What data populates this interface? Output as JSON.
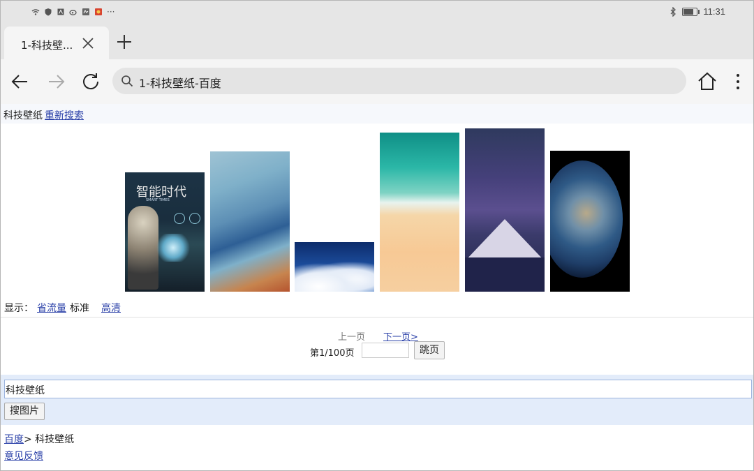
{
  "status_bar": {
    "time": "11:31",
    "left_icons": [
      "wifi-icon",
      "shield-icon",
      "notification-icon",
      "weibo-icon",
      "app-icon",
      "app-icon-2"
    ],
    "more": "···"
  },
  "browser": {
    "tab_title": "1-科技壁...",
    "address": "1-科技壁纸-百度"
  },
  "page": {
    "keyword": "科技壁纸",
    "research_link": "重新搜索",
    "display_label": "显示：",
    "display_options": {
      "save_data": "省流量",
      "standard": "标准",
      "hd": "高清"
    },
    "pager": {
      "prev": "上一页",
      "next": "下一页>",
      "count": "第1/100页",
      "jump": "跳页",
      "page_input": ""
    },
    "search": {
      "value": "科技壁纸",
      "button": "搜图片"
    },
    "breadcrumb": {
      "home": "百度",
      "sep": ">",
      "current": " 科技壁纸"
    },
    "feedback": "意见反馈",
    "images": [
      {
        "name": "image-thumb-1",
        "alt": "智能时代"
      },
      {
        "name": "image-thumb-2",
        "alt": ""
      },
      {
        "name": "image-thumb-3",
        "alt": ""
      },
      {
        "name": "image-thumb-4",
        "alt": ""
      },
      {
        "name": "image-thumb-5",
        "alt": ""
      },
      {
        "name": "image-thumb-6",
        "alt": ""
      }
    ],
    "image_text": {
      "title": "智能时代",
      "subtitle": "SMART TIMES"
    }
  },
  "colors": {
    "link": "#2a40a8",
    "search_band": "#e3ecfa"
  }
}
